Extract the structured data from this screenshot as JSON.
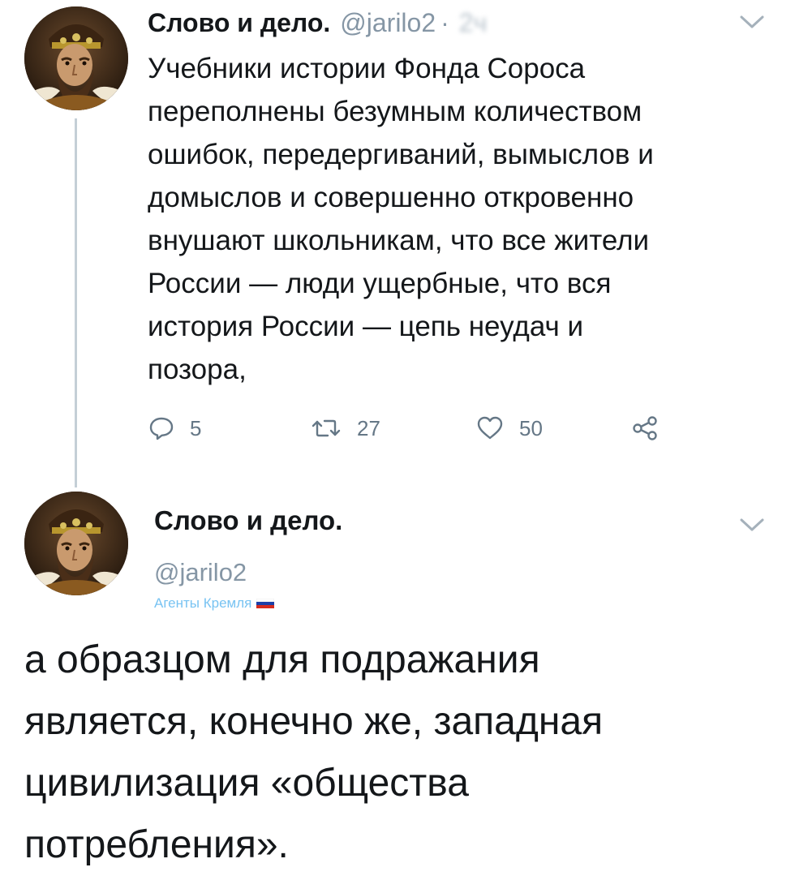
{
  "tweet1": {
    "author_name": "Слово и дело.",
    "handle": "@jarilo2",
    "separator": "·",
    "timestamp": "2ч",
    "avatar_icon": "portrait-avatar",
    "menu_icon": "chevron-down-icon",
    "text_lines": [
      "Учебники истории Фонда Сороса",
      "переполнены безумным количеством",
      "ошибок, передергиваний, вымыслов и",
      "домыслов и совершенно откровенно",
      "внушают школьникам, что все жители",
      "России — люди ущербные, что вся",
      "история России — цепь неудач и",
      "позора,"
    ],
    "actions": {
      "replies": "5",
      "retweets": "27",
      "likes": "50",
      "reply_icon": "reply-icon",
      "retweet_icon": "retweet-icon",
      "like_icon": "heart-icon",
      "share_icon": "share-icon"
    }
  },
  "tweet2": {
    "author_name": "Слово и дело.",
    "handle": "@jarilo2",
    "label": "Агенты Кремля",
    "label_icon": "russian-flag-icon",
    "avatar_icon": "portrait-avatar",
    "menu_icon": "chevron-down-icon",
    "text_lines": [
      "а образцом для подражания",
      "является, конечно же, западная",
      "цивилизация «общества",
      "потребления»."
    ]
  },
  "colors": {
    "text": "#14171a",
    "secondary": "#8596a5",
    "action_gray": "#657786",
    "thread_line": "#c4cfd6",
    "label_blue": "#78c3f2"
  }
}
